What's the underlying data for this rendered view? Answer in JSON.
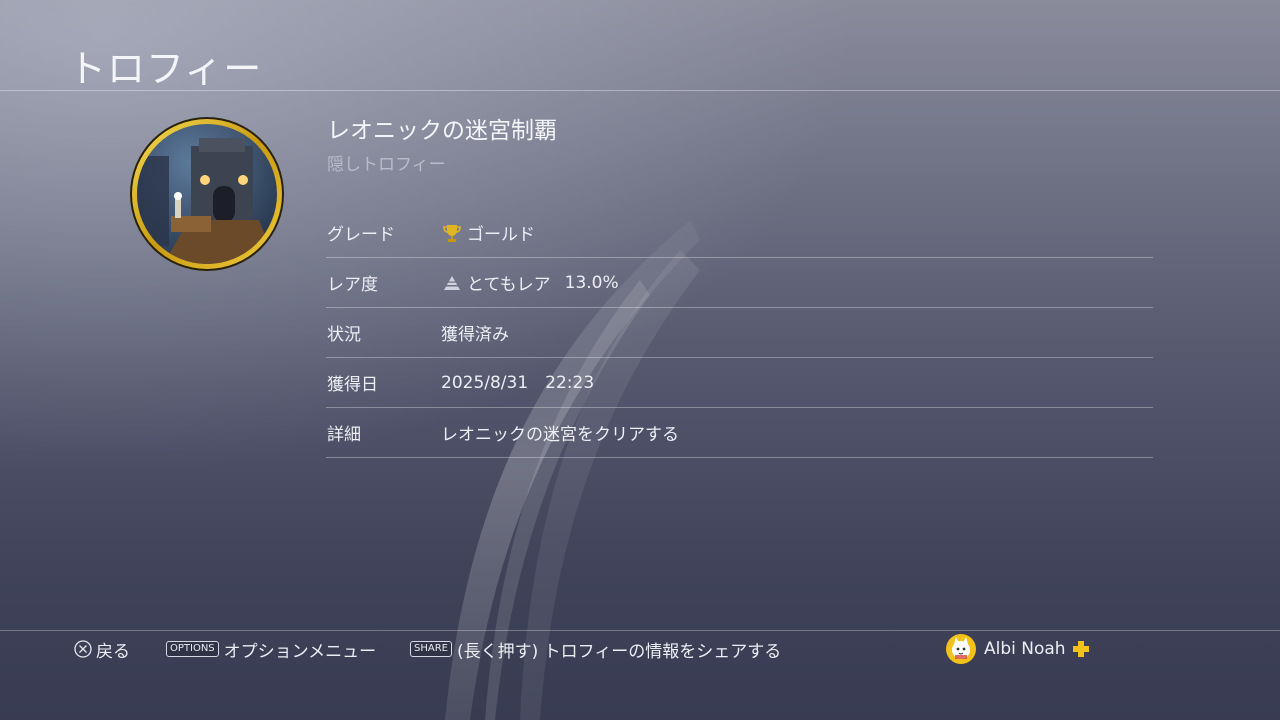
{
  "header": {
    "title": "トロフィー"
  },
  "trophy": {
    "name": "レオニックの迷宮制覇",
    "subtitle": "隠しトロフィー",
    "image_icon": "trophy-artwork-dungeon"
  },
  "details": {
    "grade": {
      "label": "グレード",
      "value": "ゴールド",
      "icon": "gold-trophy-icon"
    },
    "rarity": {
      "label": "レア度",
      "value": "とてもレア",
      "percent": "13.0%",
      "icon": "rarity-pyramid-icon"
    },
    "status": {
      "label": "状況",
      "value": "獲得済み"
    },
    "earned": {
      "label": "獲得日",
      "date": "2025/8/31",
      "time": "22:23"
    },
    "description": {
      "label": "詳細",
      "value": "レオニックの迷宮をクリアする"
    }
  },
  "footer": {
    "back_label": "戻る",
    "options_tag": "OPTIONS",
    "options_label": "オプションメニュー",
    "share_tag": "SHARE",
    "share_label": "(長く押す) トロフィーの情報をシェアする",
    "user_name": "Albi Noah"
  },
  "colors": {
    "gold": "#e0b422",
    "plus": "#f2c21a"
  }
}
